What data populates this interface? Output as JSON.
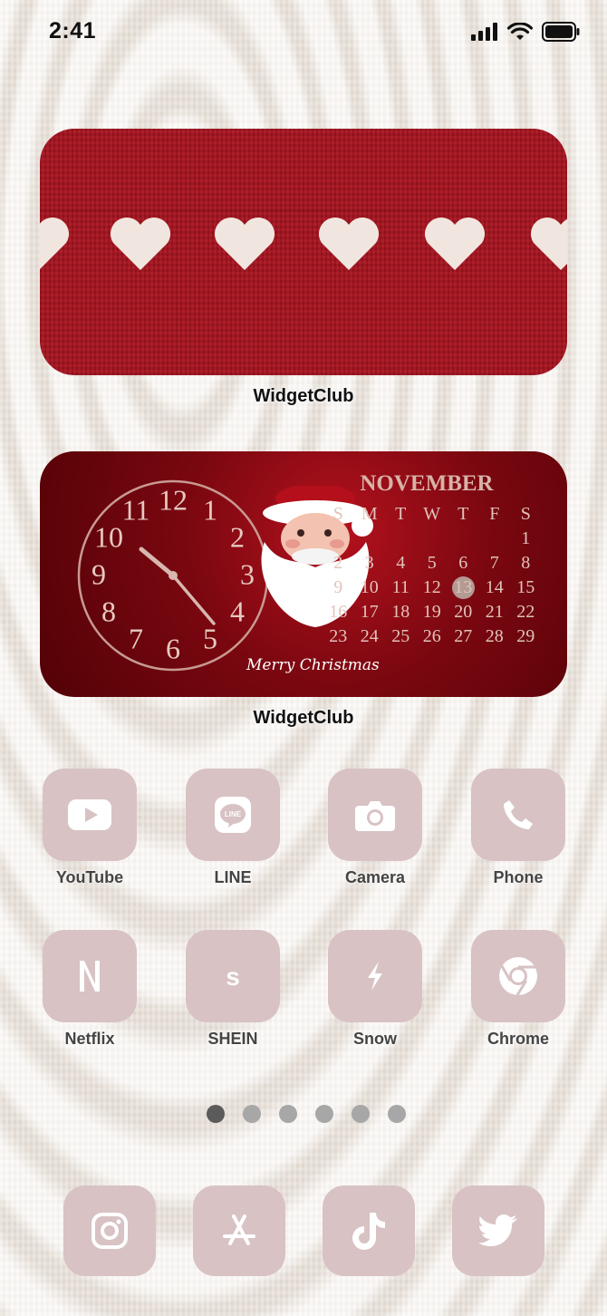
{
  "status": {
    "time": "2:41"
  },
  "widgets": [
    {
      "label": "WidgetClub"
    },
    {
      "label": "WidgetClub",
      "clock_numbers": [
        "12",
        "1",
        "2",
        "3",
        "4",
        "5",
        "6",
        "7",
        "8",
        "9",
        "10",
        "11"
      ],
      "greeting": "Merry Christmas",
      "calendar": {
        "month": "NOVEMBER",
        "weekdays": [
          "S",
          "M",
          "T",
          "W",
          "T",
          "F",
          "S"
        ],
        "weeks": [
          [
            "",
            "",
            "",
            "",
            "",
            "",
            "1"
          ],
          [
            "2",
            "3",
            "4",
            "5",
            "6",
            "7",
            "8"
          ],
          [
            "9",
            "10",
            "11",
            "12",
            "13",
            "14",
            "15"
          ],
          [
            "16",
            "17",
            "18",
            "19",
            "20",
            "21",
            "22"
          ],
          [
            "23",
            "24",
            "25",
            "26",
            "27",
            "28",
            "29"
          ]
        ],
        "today": "13"
      }
    }
  ],
  "apps": [
    {
      "label": "YouTube",
      "icon": "youtube-icon"
    },
    {
      "label": "LINE",
      "icon": "line-icon"
    },
    {
      "label": "Camera",
      "icon": "camera-icon"
    },
    {
      "label": "Phone",
      "icon": "phone-icon"
    },
    {
      "label": "Netflix",
      "icon": "netflix-icon"
    },
    {
      "label": "SHEIN",
      "icon": "shein-icon"
    },
    {
      "label": "Snow",
      "icon": "snow-icon"
    },
    {
      "label": "Chrome",
      "icon": "chrome-icon"
    }
  ],
  "page_indicator": {
    "count": 6,
    "active": 1
  },
  "dock": [
    {
      "icon": "instagram-icon"
    },
    {
      "icon": "app-store-icon"
    },
    {
      "icon": "tiktok-icon"
    },
    {
      "icon": "twitter-icon"
    }
  ],
  "colors": {
    "tile": "#d8c2c3",
    "knit_red": "#a8131f",
    "widget_dark_red": "#7a0710"
  }
}
